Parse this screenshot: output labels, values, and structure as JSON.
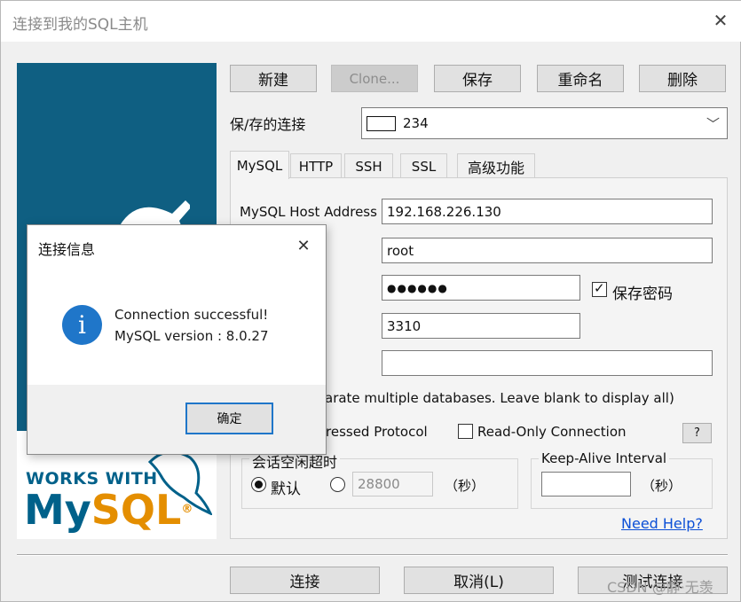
{
  "window": {
    "title": "连接到我的SQL主机",
    "close_glyph": "✕"
  },
  "toolbar": {
    "new": "新建",
    "clone": "Clone...",
    "save": "保存",
    "rename": "重命名",
    "delete": "删除"
  },
  "saved": {
    "label": "保/存的连接",
    "value": "234",
    "arrow": "﹀"
  },
  "tabs": [
    "MySQL",
    "HTTP",
    "SSH",
    "SSL",
    "高级功能"
  ],
  "form": {
    "host_label": "MySQL Host Address",
    "host_value": "192.168.226.130",
    "user_value": "root",
    "password_value": "●●●●●●",
    "save_password_label": "保存密码",
    "port_value": "3310",
    "db_value": "",
    "db_hint": "arate multiple databases. Leave blank to display all)",
    "compressed_label": "ressed Protocol",
    "readonly_label": "Read-Only Connection",
    "help_btn": "?",
    "check_mark": "✓"
  },
  "session": {
    "title": "会话空闲超时",
    "default_label": "默认",
    "custom_value": "28800",
    "unit": "（秒）"
  },
  "keepalive": {
    "title": "Keep-Alive Interval",
    "value": "",
    "unit": "（秒）"
  },
  "help_link": "Need Help?",
  "banner": {
    "works_with": "WORKS WITH",
    "brand_my": "My",
    "brand_sql": "SQL",
    "reg": "®"
  },
  "footer": {
    "connect": "连接",
    "cancel": "取消(L)",
    "test": "测试连接"
  },
  "watermark": "CSDN @静·无羡",
  "dialog": {
    "title": "连接信息",
    "close_glyph": "✕",
    "info_glyph": "i",
    "line1": "Connection successful!",
    "line2": "MySQL version : 8.0.27",
    "ok": "确定"
  },
  "colors": {
    "accent_blue": "#0f5f82",
    "info_icon": "#1f76c9",
    "link": "#0b4fd6",
    "mysql_blue": "#00618a",
    "mysql_orange": "#e48e00"
  }
}
